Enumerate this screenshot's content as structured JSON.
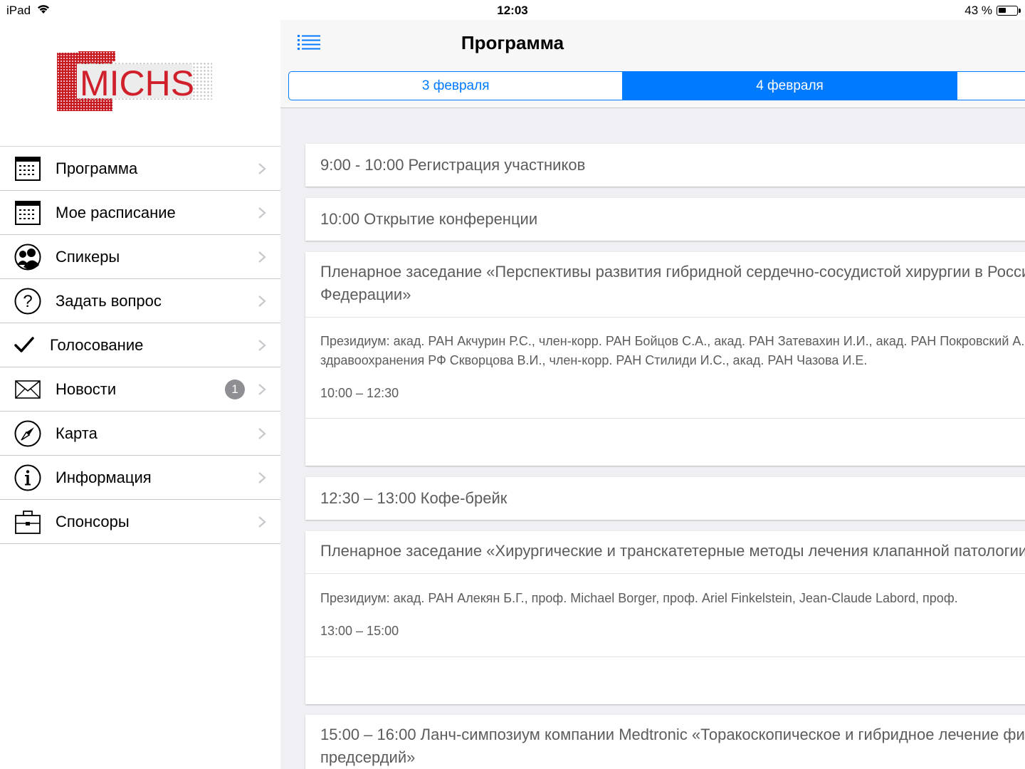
{
  "status_bar": {
    "device": "iPad",
    "time": "12:03",
    "battery": "43 %",
    "battery_level": 0.43
  },
  "sidebar": {
    "logo_text": "MICHS",
    "items": [
      {
        "label": "Программа",
        "icon": "calendar-icon"
      },
      {
        "label": "Мое расписание",
        "icon": "calendar-icon"
      },
      {
        "label": "Спикеры",
        "icon": "people-icon"
      },
      {
        "label": "Задать вопрос",
        "icon": "question-icon"
      },
      {
        "label": "Голосование",
        "icon": "checkmark-icon"
      },
      {
        "label": "Новости",
        "icon": "envelope-icon",
        "badge": "1"
      },
      {
        "label": "Карта",
        "icon": "compass-icon"
      },
      {
        "label": "Информация",
        "icon": "info-icon"
      },
      {
        "label": "Спонсоры",
        "icon": "briefcase-icon"
      }
    ]
  },
  "header": {
    "title": "Программа",
    "menu_icon": "list-icon",
    "tabs": [
      {
        "label": "3 февраля",
        "selected": false
      },
      {
        "label": "4 февраля",
        "selected": true
      }
    ]
  },
  "schedule": [
    {
      "title": "9:00 - 10:00 Регистрация участников"
    },
    {
      "title": "10:00 Открытие конференции"
    },
    {
      "title_line1": "Пленарное заседание «Перспективы развития гибридной сердечно-сосудистой хирургии в Российской",
      "title_line2": "Федерации»",
      "presidium_line1": "Президиум: акад. РАН Акчурин Р.С., член-корр. РАН Бойцов С.А., акад. РАН Затевахин И.И., акад. РАН Покровский А.В., министр",
      "presidium_line2": "здравоохранения РФ Скворцова В.И., член-корр. РАН Стилиди И.С., акад. РАН Чазова И.Е.",
      "time": "10:00 – 12:30"
    },
    {
      "title": "12:30 – 13:00 Кофе-брейк"
    },
    {
      "title_line1": "Пленарное заседание «Хирургические и транскатетерные методы лечения клапанной патологии»",
      "presidium_line1": "Президиум: акад. РАН Алекян Б.Г., проф. Michael Borger, проф. Ariel Finkelstein, Jean-Claude Labord, проф.",
      "time": "13:00 – 15:00"
    },
    {
      "title_line1": "15:00 – 16:00 Ланч-симпозиум компании Medtronic «Торакоскопическое и гибридное лечение фибрилляции",
      "title_line2": "предсердий»"
    }
  ],
  "colors": {
    "accent": "#007aff",
    "background": "#efeff4",
    "text_secondary": "#5c5c5c",
    "logo_red": "#d0202b"
  }
}
